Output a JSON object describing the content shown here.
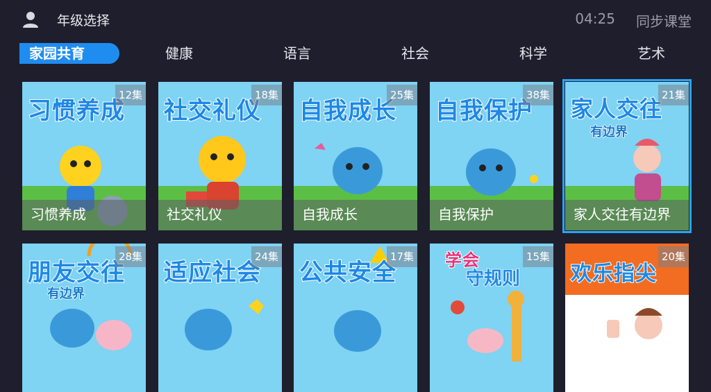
{
  "header": {
    "grade_label": "年级选择",
    "time": "04:25",
    "app_title": "同步课堂"
  },
  "tabs": [
    {
      "label": "家园共育",
      "active": true
    },
    {
      "label": "健康",
      "active": false
    },
    {
      "label": "语言",
      "active": false
    },
    {
      "label": "社会",
      "active": false
    },
    {
      "label": "科学",
      "active": false
    },
    {
      "label": "艺术",
      "active": false
    }
  ],
  "cards": [
    {
      "cover_title": "习惯养成",
      "cover_sub": "",
      "count": "12集",
      "label": "习惯养成"
    },
    {
      "cover_title": "社交礼仪",
      "cover_sub": "",
      "count": "18集",
      "label": "社交礼仪"
    },
    {
      "cover_title": "自我成长",
      "cover_sub": "",
      "count": "25集",
      "label": "自我成长"
    },
    {
      "cover_title": "自我保护",
      "cover_sub": "",
      "count": "38集",
      "label": "自我保护"
    },
    {
      "cover_title": "家人交往",
      "cover_sub": "有边界",
      "count": "21集",
      "label": "家人交往有边界"
    },
    {
      "cover_title": "朋友交往",
      "cover_sub": "有边界",
      "count": "28集",
      "label": ""
    },
    {
      "cover_title": "适应社会",
      "cover_sub": "",
      "count": "24集",
      "label": ""
    },
    {
      "cover_title": "公共安全",
      "cover_sub": "",
      "count": "17集",
      "label": ""
    },
    {
      "cover_title": "学会",
      "cover_sub": "守规则",
      "count": "15集",
      "label": ""
    },
    {
      "cover_title": "欢乐指尖",
      "cover_sub": "",
      "count": "20集",
      "label": ""
    }
  ],
  "colors": {
    "background": "#1e1e2c",
    "accent": "#1f8cf0",
    "selected_border": "#2aa3f5"
  }
}
